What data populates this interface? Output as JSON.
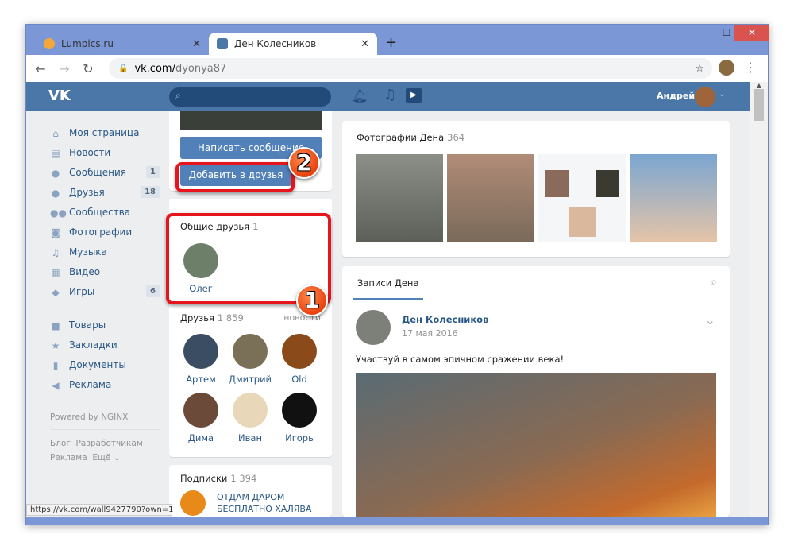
{
  "browser": {
    "tabs": [
      {
        "title": "Lumpics.ru",
        "active": false
      },
      {
        "title": "Ден Колесников",
        "active": true
      }
    ],
    "new_tab": "+",
    "url_domain": "vk.com/",
    "url_path": "dyonya87",
    "status_url": "https://vk.com/wall9427790?own=1"
  },
  "header": {
    "user_name": "Андрей",
    "search_placeholder": ""
  },
  "sidebar": {
    "items": [
      {
        "label": "Моя страница",
        "icon": "home-icon",
        "glyph": "⌂"
      },
      {
        "label": "Новости",
        "icon": "news-icon",
        "glyph": "▤"
      },
      {
        "label": "Сообщения",
        "icon": "messages-icon",
        "glyph": "●",
        "badge": "1"
      },
      {
        "label": "Друзья",
        "icon": "friends-icon",
        "glyph": "●",
        "badge": "18"
      },
      {
        "label": "Сообщества",
        "icon": "groups-icon",
        "glyph": "●●"
      },
      {
        "label": "Фотографии",
        "icon": "camera-icon",
        "glyph": "◙"
      },
      {
        "label": "Музыка",
        "icon": "music-icon",
        "glyph": "♫"
      },
      {
        "label": "Видео",
        "icon": "video-icon",
        "glyph": "▦"
      },
      {
        "label": "Игры",
        "icon": "games-icon",
        "glyph": "◆",
        "badge": "6"
      }
    ],
    "items2": [
      {
        "label": "Товары",
        "icon": "bag-icon",
        "glyph": "■"
      },
      {
        "label": "Закладки",
        "icon": "star-icon",
        "glyph": "★"
      },
      {
        "label": "Документы",
        "icon": "document-icon",
        "glyph": "▮"
      },
      {
        "label": "Реклама",
        "icon": "ads-icon",
        "glyph": "◀"
      }
    ],
    "powered": "Powered by NGINX",
    "footer_links": [
      "Блог",
      "Разработчикам",
      "Реклама",
      "Ещё ⌄"
    ]
  },
  "profile": {
    "write_message": "Написать сообщение",
    "add_friend": "Добавить в друзья",
    "mutual": {
      "title": "Общие друзья",
      "count": "1",
      "friends": [
        "Олег"
      ]
    },
    "friends": {
      "title": "Друзья",
      "count": "1 859",
      "link": "новости",
      "list": [
        "Артем",
        "Дмитрий",
        "Old",
        "Дима",
        "Иван",
        "Игорь"
      ]
    },
    "subs": {
      "title": "Подписки",
      "count": "1 394",
      "first": "ОТДАМ ДАРОМ БЕСПЛАТНО ХАЛЯВА"
    }
  },
  "photos": {
    "title": "Фотографии Дена",
    "count": "364"
  },
  "wall": {
    "tab": "Записи Дена",
    "author": "Ден Колесников",
    "date": "17 мая 2016",
    "text": "Участвуй в самом эпичном сражении века!"
  },
  "annotations": [
    "1",
    "2"
  ],
  "colors": {
    "vk_blue": "#4a76a8",
    "highlight": "#e8141b"
  }
}
